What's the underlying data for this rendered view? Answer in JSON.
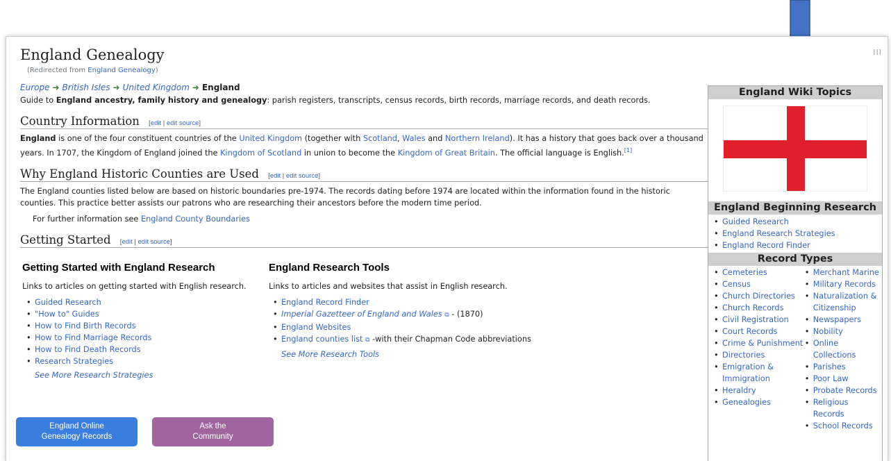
{
  "page": {
    "title": "England Genealogy",
    "redirect_prefix": "(Redirected from ",
    "redirect_link": "England Genealogy",
    "redirect_suffix": ")",
    "corner_icon": "III"
  },
  "breadcrumb": {
    "items": [
      "Europe",
      "British Isles",
      "United Kingdom"
    ],
    "current": "England"
  },
  "intro": {
    "prefix": "Guide to ",
    "bold": "England ancestry, family history and genealogy",
    "suffix": ": parish registers, transcripts, census records, birth records, marriage records, and death records."
  },
  "edit_links": {
    "open": "[",
    "edit": "edit",
    "sep": " | ",
    "edit_source": "edit source",
    "close": "]"
  },
  "country_info": {
    "heading": "Country Information",
    "t1": "England",
    "t2": " is one of the four constituent countries of the ",
    "l1": "United Kingdom",
    "t3": " (together with ",
    "l2": "Scotland",
    "t4": ", ",
    "l3": "Wales",
    "t5": " and ",
    "l4": "Northern Ireland",
    "t6": "). It has a history that goes back over a thousand years. In 1707, the Kingdom of England joined the ",
    "l5": "Kingdom of Scotland",
    "t7": " in union to become the ",
    "l6": "Kingdom of Great Britain",
    "t8": ". The official language is English.",
    "ref": "[1]"
  },
  "historic_counties": {
    "heading": "Why England Historic Counties are Used",
    "text": "The England counties listed below are based on historic boundaries pre-1974. The records dating before 1974 are located within the information found in the historic counties. This practice better assists our patrons who are researching their ancestors before the modern time period.",
    "further_prefix": "For further information see ",
    "further_link": "England County Boundaries"
  },
  "getting_started": {
    "heading": "Getting Started",
    "col1": {
      "title": "Getting Started with England Research",
      "desc": "Links to articles on getting started with English research.",
      "links": [
        "Guided Research",
        "\"How to\" Guides",
        "How to Find Birth Records",
        "How to Find Marriage Records",
        "How to Find Death Records",
        "Research Strategies"
      ],
      "more": "See More Research Strategies"
    },
    "col2": {
      "title": "England Research Tools",
      "desc": "Links to articles and websites that assist in English research.",
      "link1": "England Record Finder",
      "link2": "Imperial Gazetteer of England and Wales",
      "link2_suffix": " - (1870)",
      "link3": "England Websites",
      "link4": "England counties list",
      "link4_suffix": " -with their Chapman Code abbreviations",
      "more": "See More Research Tools",
      "ext_icon": "⧉"
    }
  },
  "buttons": {
    "online_records": "England Online\nGenealogy Records",
    "ask_community": "Ask the\nCommunity",
    "online_color": "#3a7ee0",
    "community_color": "#a0649f"
  },
  "sidebar": {
    "topics_heading": "England Wiki Topics",
    "beginning_heading": "England Beginning Research",
    "beginning_links": [
      "Guided Research",
      "England Research Strategies",
      "England Record Finder"
    ],
    "record_types_heading": "Record Types",
    "record_types_col1": [
      "Cemeteries",
      "Census",
      "Church Directories",
      "Church Records",
      "Civil Registration",
      "Court Records",
      "Crime & Punishment",
      "Directories",
      "Emigration & Immigration",
      "Heraldry",
      "Genealogies"
    ],
    "record_types_col2": [
      "Merchant Marine",
      "Military Records",
      "Naturalization & Citizenship",
      "Newspapers",
      "Nobility",
      "Online Collections",
      "Parishes",
      "Poor Law",
      "Probate Records",
      "Religious Records",
      "School Records"
    ],
    "flag_color": "#e0202c"
  },
  "annotation": {
    "arrow_color": "#4472c4"
  }
}
